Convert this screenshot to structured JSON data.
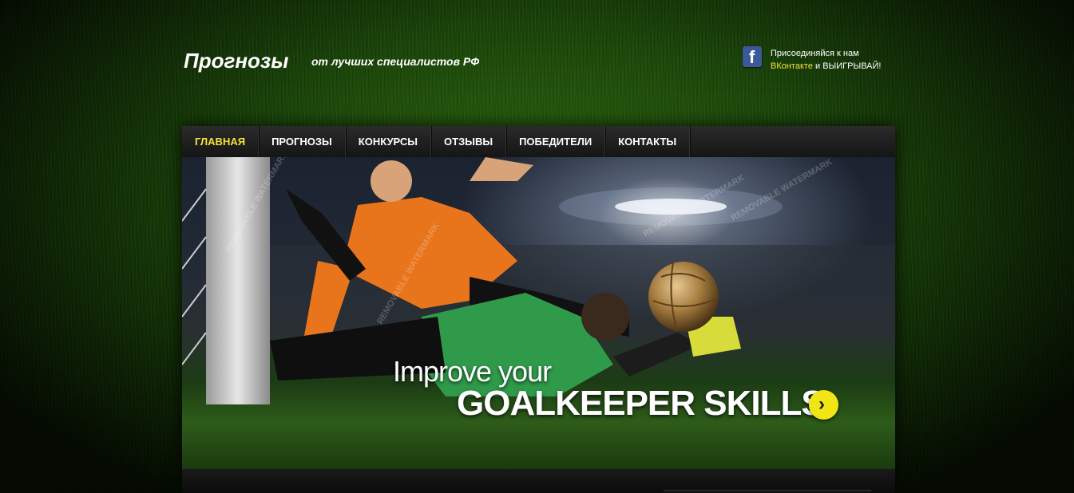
{
  "header": {
    "title": "Прогнозы",
    "subtitle": "от лучших специалистов РФ"
  },
  "social": {
    "icon": "facebook-icon",
    "icon_glyph": "f",
    "line1": "Присоединяйся к нам",
    "vk_link": "ВКонтакте",
    "line2_rest": " и ВЫИГРЫВАЙ!"
  },
  "nav": {
    "items": [
      {
        "label": "ГЛАВНАЯ",
        "active": true
      },
      {
        "label": "ПРОГНОЗЫ",
        "active": false
      },
      {
        "label": "КОНКУРСЫ",
        "active": false
      },
      {
        "label": "ОТЗЫВЫ",
        "active": false
      },
      {
        "label": "ПОБЕДИТЕЛИ",
        "active": false
      },
      {
        "label": "КОНТАКТЫ",
        "active": false
      }
    ]
  },
  "hero": {
    "line1": "Improve your",
    "line2": "GOALKEEPER SKILLS",
    "arrow_icon": "chevron-right-icon",
    "arrow_glyph": "›"
  },
  "colors": {
    "accent_yellow": "#f3e23a",
    "nav_bg": "#1e1e1e",
    "facebook_blue": "#3b5998"
  }
}
